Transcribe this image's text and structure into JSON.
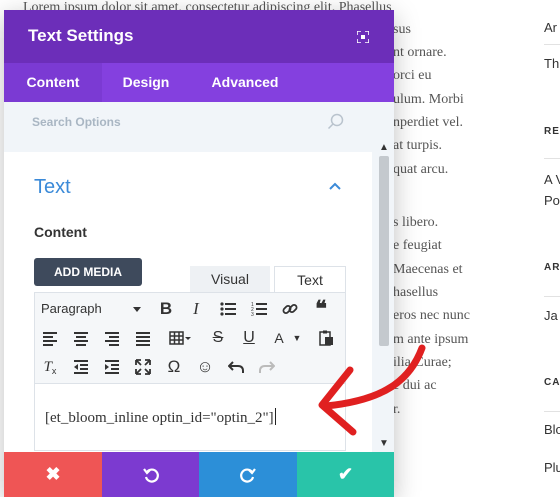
{
  "background_article": {
    "lines": [
      "Lorem ipsum dolor sit amet, consectetur adipiscing elit. Phasellus",
      "sus",
      "nt ornare.",
      "orci eu",
      "ulum. Morbi",
      "nperdiet vel.",
      "at turpis.",
      "quat arcu.",
      "s libero.",
      "e feugiat",
      "Maecenas et",
      "hasellus",
      "eros nec nunc",
      "m ante ipsum",
      "ilia Curae;",
      "e dui ac",
      "r."
    ]
  },
  "background_sidebar": {
    "items": [
      "Ar",
      "Th",
      "RE",
      "A V",
      "Po",
      "AR",
      "Ja",
      "CA",
      "Blo",
      "Plu"
    ]
  },
  "modal": {
    "title": "Text Settings",
    "expand_icon": "expand-icon",
    "tabs": [
      "Content",
      "Design",
      "Advanced"
    ],
    "active_tab": "Content",
    "search": {
      "placeholder": "Search Options"
    },
    "section": {
      "title": "Text",
      "field_label": "Content",
      "add_media_label": "ADD MEDIA",
      "editor_tabs": [
        "Visual",
        "Text"
      ],
      "active_editor_tab": "Text",
      "format_select": "Paragraph",
      "content": "[et_bloom_inline optin_id=\"optin_2\"]"
    },
    "toolbar_icons": [
      "bold-icon",
      "italic-icon",
      "bullet-list-icon",
      "numbered-list-icon",
      "link-icon",
      "blockquote-icon",
      "align-left-icon",
      "align-center-icon",
      "align-right-icon",
      "align-justify-icon",
      "table-icon",
      "strikethrough-icon",
      "underline-icon",
      "text-color-icon",
      "paste-icon",
      "clear-formatting-icon",
      "outdent-icon",
      "indent-icon",
      "fullscreen-icon",
      "special-character-icon",
      "emoticon-icon",
      "undo-icon",
      "redo-icon"
    ]
  },
  "footer_buttons": [
    "close-icon",
    "undo-icon",
    "redo-icon",
    "check-icon"
  ],
  "colors": {
    "header": "#6c2eb9",
    "tabs": "#8440df",
    "accent_blue": "#3b8ad8",
    "close": "#ef5555",
    "undo": "#7c3ad0",
    "redo": "#2c8fd8",
    "save": "#29c4a9",
    "annotation_arrow": "#e02020"
  }
}
